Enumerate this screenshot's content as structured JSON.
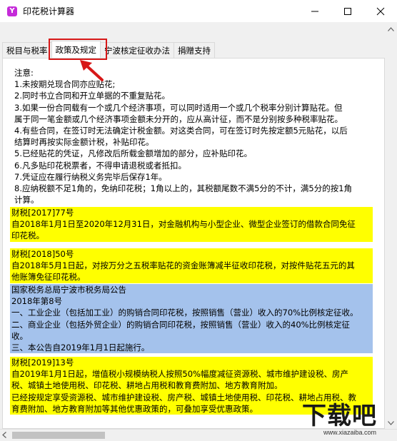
{
  "window": {
    "title": "印花税计算器",
    "icon_text": "Y",
    "icon_color": "#c52bd9"
  },
  "tabs": [
    {
      "label": "税目与税率"
    },
    {
      "label": "政策及规定"
    },
    {
      "label": "宁波核定征收办法"
    },
    {
      "label": "捐赠支持"
    }
  ],
  "active_tab": "政策及规定",
  "notes": {
    "heading": "注意:",
    "items": [
      "1.未按期兑现合同亦应贴花;",
      "2.同时书立合同和开立单据的不重复贴花。",
      "3.如果一份合同载有一个或几个经济事项，可以同时适用一个或几个税率分别计算贴花。但",
      "属于同一笔金额或几个经济事项金额未分开的，应从高计征，而不是分别按多种税率贴花。",
      "4.有些合同，在签订时无法确定计税金额。对这类合同，可在签订时先按定额5元贴花，以后",
      "结算时再按实际金额计税，补贴印花。",
      "5.已经贴花的凭证，凡修改后所载金额增加的部分，应补贴印花。",
      "6.凡多贴印花税票者，不得申请退税或者抵扣。",
      "7.凭证应在履行纳税义务完毕后保存1年。",
      "8.应纳税额不足1角的，免纳印花税；1角以上的，其税额尾数不满5分的不计，满5分的按1角",
      "计算。"
    ]
  },
  "blocks": [
    {
      "color": "yellow",
      "lines": [
        "财税[2017]77号",
        "自2018年1月1日至2020年12月31日，对金融机构与小型企业、微型企业签订的借款合同免征",
        "印花税。"
      ]
    },
    {
      "color": "yellow",
      "lines": [
        "财税[2018]50号",
        "自2018年5月1日起，对按万分之五税率贴花的资金账簿减半征收印花税，对按件贴花五元的其",
        "他账簿免征印花税。"
      ]
    },
    {
      "color": "blue",
      "lines": [
        "国家税务总局宁波市税务局公告",
        "2018年第8号",
        "一、工业企业（包括加工业）的购销合同印花税，按照销售（营业）收入的70%比例核定征收。",
        "二、商业企业（包括外贸企业）的购销合同印花税，按照销售（营业）收入的40%比例核定征",
        "收。",
        "三、本公告自2019年1月1日起施行。"
      ]
    },
    {
      "color": "yellow",
      "lines": [
        "财税[2019]13号",
        "自2019年1月1日起，增值税小规模纳税人按照50%幅度减征资源税、城市维护建设税、房产",
        "税、城镇土地使用税、印花税、耕地占用税和教育费附加、地方教育附加。",
        "已经按规定享受资源税、城市维护建设税、房产税、城镇土地使用税、印花税、耕地占用税、教",
        "育费附加、地方教育附加等其他优惠政策的，可叠加享受优惠政策。"
      ]
    }
  ],
  "colors": {
    "highlight_yellow": "#ffff00",
    "highlight_blue": "#a4c2ec",
    "annotation_red": "#d71818"
  },
  "watermark": {
    "main": "下载吧",
    "sub": "www.xiazaiba.com"
  }
}
